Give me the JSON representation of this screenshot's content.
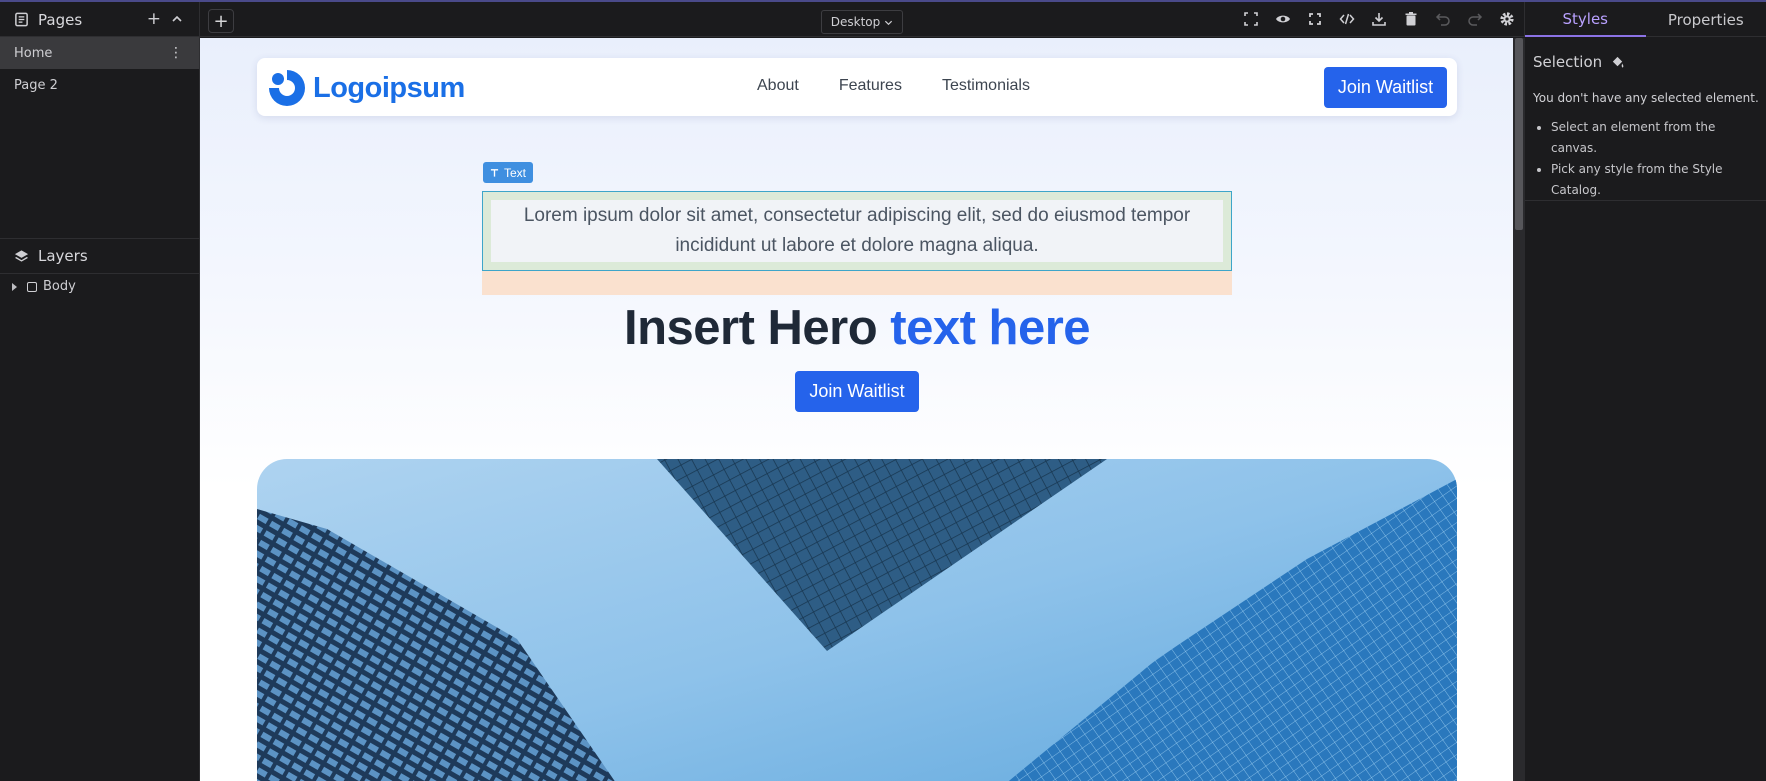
{
  "sidebar": {
    "pages_title": "Pages",
    "pages": [
      {
        "label": "Home"
      },
      {
        "label": "Page 2"
      }
    ],
    "layers_title": "Layers",
    "layers": [
      {
        "label": "Body"
      }
    ]
  },
  "toolbar": {
    "device": "Desktop",
    "icons": [
      "select-outline-icon",
      "preview-eye-icon",
      "fullscreen-icon",
      "code-icon",
      "download-icon",
      "delete-icon",
      "undo-icon",
      "redo-icon",
      "settings-icon"
    ]
  },
  "right_panel": {
    "tabs": [
      "Styles",
      "Properties"
    ],
    "active_tab": "Styles",
    "selection_label": "Selection",
    "no_selection_msg": "You don't have any selected element.",
    "hints": [
      "Select an element from the canvas.",
      "Pick any style from the Style Catalog."
    ]
  },
  "canvas": {
    "logo_text": "Logoipsum",
    "nav_links": [
      "About",
      "Features",
      "Testimonials"
    ],
    "nav_cta": "Join Waitlist",
    "selected_badge": "Text",
    "selected_text": "Lorem ipsum dolor sit amet, consectetur adipiscing elit, sed do eiusmod tempor incididunt ut labore et dolore magna aliqua.",
    "hero_title_plain": "Insert Hero",
    "hero_title_accent": "text here",
    "hero_cta": "Join Waitlist"
  },
  "colors": {
    "brand_blue": "#2563eb",
    "logo_blue": "#1a6fe6",
    "active_tab": "#b9a1ff",
    "selection_outline": "#3da5c9",
    "margin_highlight": "#fae1cf",
    "padding_highlight": "#dcead8"
  }
}
